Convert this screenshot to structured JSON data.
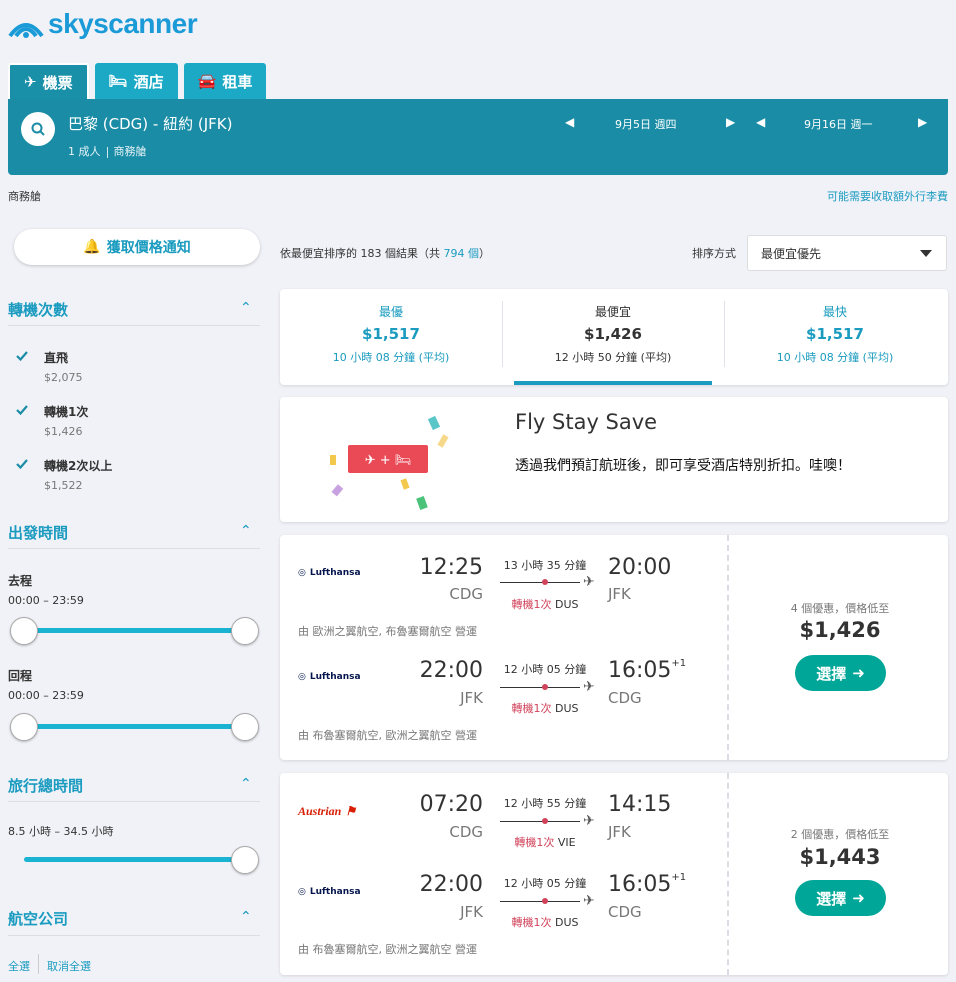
{
  "logo": {
    "text": "skyscanner"
  },
  "tabs": [
    {
      "label": "機票",
      "icon": "plane-icon"
    },
    {
      "label": "酒店",
      "icon": "bed-icon"
    },
    {
      "label": "租車",
      "icon": "car-icon"
    }
  ],
  "search": {
    "route": "巴黎 (CDG) - 紐約 (JFK)",
    "passengers": "1 成人",
    "cabin": "商務艙",
    "depart_date": "9月5日 週四",
    "return_date": "9月16日 週一"
  },
  "cabin_label": "商務艙",
  "baggage_notice": "可能需要收取額外行李費",
  "price_alert": {
    "label": "獲取價格通知"
  },
  "filters": {
    "stops": {
      "title": "轉機次數",
      "options": [
        {
          "label": "直飛",
          "price": "$2,075",
          "checked": true
        },
        {
          "label": "轉機1次",
          "price": "$1,426",
          "checked": true
        },
        {
          "label": "轉機2次以上",
          "price": "$1,522",
          "checked": true
        }
      ]
    },
    "times": {
      "title": "出發時間",
      "outbound_label": "去程",
      "outbound_range": "00:00 – 23:59",
      "return_label": "回程",
      "return_range": "00:00 – 23:59"
    },
    "duration": {
      "title": "旅行總時間",
      "range": "8.5 小時 – 34.5 小時"
    },
    "airlines": {
      "title": "航空公司",
      "select_all": "全選",
      "clear_all": "取消全選"
    }
  },
  "results": {
    "count_prefix": "依最便宜排序的 183 個結果（共 ",
    "total": "794 個",
    "count_suffix": "）",
    "sort_label": "排序方式",
    "sort_value": "最便宜優先"
  },
  "summary": [
    {
      "title": "最優",
      "price": "$1,517",
      "duration": "10 小時 08 分鐘 (平均)"
    },
    {
      "title": "最便宜",
      "price": "$1,426",
      "duration": "12 小時 50 分鐘 (平均)"
    },
    {
      "title": "最快",
      "price": "$1,517",
      "duration": "10 小時 08 分鐘 (平均)"
    }
  ],
  "promo": {
    "title": "Fly Stay Save",
    "description": "透過我們預訂航班後，即可享受酒店特別折扣。哇噢！"
  },
  "cards": [
    {
      "legs": [
        {
          "airline": "Lufthansa",
          "dep_time": "12:25",
          "dep_airport": "CDG",
          "duration": "13 小時 35 分鐘",
          "stops": "轉機1次",
          "via": "DUS",
          "arr_time": "20:00",
          "arr_airport": "JFK",
          "day_offset": ""
        },
        {
          "airline": "Lufthansa",
          "dep_time": "22:00",
          "dep_airport": "JFK",
          "duration": "12 小時 05 分鐘",
          "stops": "轉機1次",
          "via": "DUS",
          "arr_time": "16:05",
          "arr_airport": "CDG",
          "day_offset": "+1"
        }
      ],
      "operated": [
        "由 歐洲之翼航空, 布魯塞爾航空 營運",
        "由 布魯塞爾航空, 歐洲之翼航空 營運"
      ],
      "deals": "4 個優惠，價格低至",
      "price": "$1,426",
      "select": "選擇"
    },
    {
      "legs": [
        {
          "airline": "Austrian",
          "dep_time": "07:20",
          "dep_airport": "CDG",
          "duration": "12 小時 55 分鐘",
          "stops": "轉機1次",
          "via": "VIE",
          "arr_time": "14:15",
          "arr_airport": "JFK",
          "day_offset": ""
        },
        {
          "airline": "Lufthansa",
          "dep_time": "22:00",
          "dep_airport": "JFK",
          "duration": "12 小時 05 分鐘",
          "stops": "轉機1次",
          "via": "DUS",
          "arr_time": "16:05",
          "arr_airport": "CDG",
          "day_offset": "+1"
        }
      ],
      "operated": [
        "由 布魯塞爾航空, 歐洲之翼航空 營運"
      ],
      "deals": "2 個優惠，價格低至",
      "price": "$1,443",
      "select": "選擇"
    }
  ],
  "colors": {
    "brand": "#1a9bd7",
    "header": "#1a8ca5",
    "accent": "#1a9bbf",
    "cta": "#00a698",
    "stops": "#d1435b"
  }
}
